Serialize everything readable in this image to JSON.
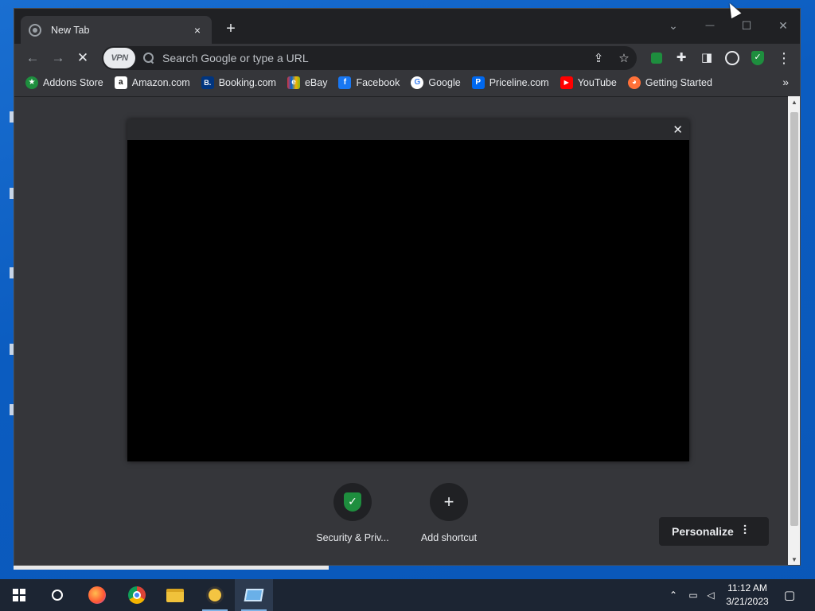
{
  "browser": {
    "tab": {
      "title": "New Tab",
      "close": "×"
    },
    "new_tab": "+",
    "window_controls": {
      "tabsearch": "⌄",
      "minimize": "—",
      "maximize": "☐",
      "close": "✕"
    },
    "toolbar": {
      "back": "←",
      "forward": "→",
      "stop": "✕",
      "vpn_badge": "VPN",
      "omnibox_placeholder": "Search Google or type a URL",
      "share": "⇪",
      "bookmark_star": "☆",
      "extensions": "✚",
      "sidepanel": "◨",
      "menu": "⋮"
    },
    "bookmarks": [
      {
        "label": "Addons Store",
        "icon": "addons-store-icon",
        "color": "#1e8e3e",
        "glyph": "★"
      },
      {
        "label": "Amazon.com",
        "icon": "amazon-icon",
        "color": "#ffffff",
        "glyph": "a"
      },
      {
        "label": "Booking.com",
        "icon": "booking-icon",
        "color": "#003580",
        "glyph": "B."
      },
      {
        "label": "eBay",
        "icon": "ebay-icon",
        "color": "#e53238",
        "glyph": "e"
      },
      {
        "label": "Facebook",
        "icon": "facebook-icon",
        "color": "#1877f2",
        "glyph": "f"
      },
      {
        "label": "Google",
        "icon": "google-icon",
        "color": "#ffffff",
        "glyph": "G"
      },
      {
        "label": "Priceline.com",
        "icon": "priceline-icon",
        "color": "#0068ef",
        "glyph": "P"
      },
      {
        "label": "YouTube",
        "icon": "youtube-icon",
        "color": "#ff0000",
        "glyph": "▶"
      },
      {
        "label": "Getting Started",
        "icon": "firefox-icon",
        "color": "#ff7139",
        "glyph": "◕"
      }
    ],
    "bookmarks_more": "»",
    "dialog_close": "✕",
    "shortcuts": [
      {
        "label": "Security & Priv...",
        "icon": "shield-check-icon"
      },
      {
        "label": "Add shortcut",
        "icon": "plus-icon"
      }
    ],
    "personalize": {
      "label": "Personalize",
      "icon": "sliders-icon"
    }
  },
  "taskbar": {
    "clock_time": "11:12 AM",
    "clock_date": "3/21/2023"
  },
  "colors": {
    "window_bg": "#35363a",
    "titlebar_bg": "#202124",
    "accent_green": "#1e8e3e",
    "desktop_blue": "#0b5cc0",
    "taskbar_bg": "#1c2533"
  }
}
